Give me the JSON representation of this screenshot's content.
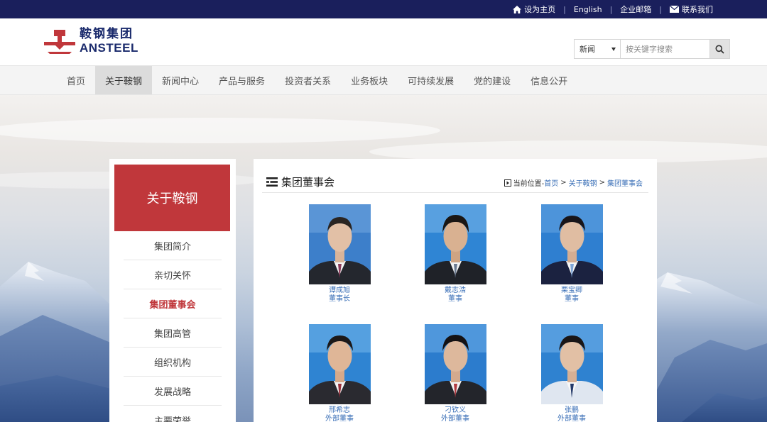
{
  "topbar": {
    "links": [
      {
        "label": "设为主页",
        "icon": "home-icon"
      },
      {
        "label": "English"
      },
      {
        "label": "企业邮箱"
      },
      {
        "label": "联系我们",
        "icon": "mail-icon"
      }
    ],
    "separator": "|"
  },
  "logo": {
    "cn": "鞍钢集团",
    "en": "ANSTEEL"
  },
  "search": {
    "category": "新闻",
    "placeholder": "按关键字搜索"
  },
  "nav": {
    "items": [
      "首页",
      "关于鞍钢",
      "新闻中心",
      "产品与服务",
      "投资者关系",
      "业务板块",
      "可持续发展",
      "党的建设",
      "信息公开"
    ],
    "active_index": 1
  },
  "sidebar": {
    "title": "关于鞍钢",
    "items": [
      "集团简介",
      "亲切关怀",
      "集团董事会",
      "集团高管",
      "组织机构",
      "发展战略",
      "主要荣誉"
    ],
    "active_index": 2
  },
  "main": {
    "title": "集团董事会",
    "breadcrumb": {
      "prefix": "当前位置-",
      "home": "首页",
      "sep": ">",
      "section": "关于鞍钢",
      "current": "集团董事会"
    },
    "members": [
      {
        "name": "谭成旭",
        "title": "董事长"
      },
      {
        "name": "戴志浩",
        "title": "董事"
      },
      {
        "name": "栗宝卿",
        "title": "董事"
      },
      {
        "name": "邢希志",
        "title": "外部董事"
      },
      {
        "name": "刁钦义",
        "title": "外部董事"
      },
      {
        "name": "张鹏",
        "title": "外部董事"
      }
    ]
  },
  "colors": {
    "topbar": "#1a1f5c",
    "accent_red": "#c0373b",
    "link_blue": "#3a6fb7",
    "photo_bg": "#2f7fd0"
  }
}
